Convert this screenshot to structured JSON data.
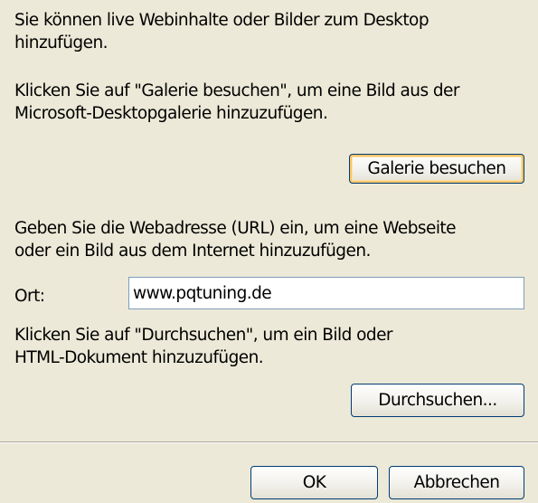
{
  "intro": {
    "line1": "Sie können live Webinhalte oder Bilder zum Desktop\nhinzufügen."
  },
  "gallery": {
    "text": "Klicken Sie auf \"Galerie besuchen\", um eine Bild aus der\nMicrosoft-Desktopgalerie hinzuzufügen.",
    "button_label": "Galerie besuchen"
  },
  "url": {
    "text": "Geben Sie die Webadresse (URL) ein, um eine Webseite\noder ein Bild aus dem Internet hinzuzufügen.",
    "location_label": "Ort:",
    "location_value": "www.pqtuning.de"
  },
  "browse": {
    "text": "Klicken Sie auf \"Durchsuchen\", um ein Bild oder\nHTML-Dokument hinzuzufügen.",
    "button_label": "Durchsuchen..."
  },
  "footer": {
    "ok_label": "OK",
    "cancel_label": "Abbrechen"
  },
  "colors": {
    "dialog_background": "#ECE9D8",
    "button_border": "#003C74",
    "focus_highlight": "#F8C56B",
    "field_border": "#7F9DB9"
  }
}
